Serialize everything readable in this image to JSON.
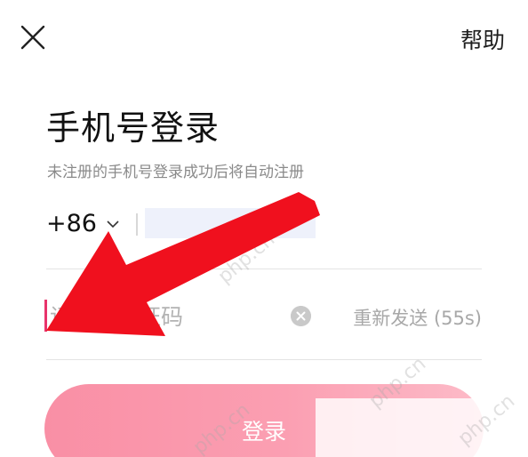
{
  "header": {
    "close_icon": "close-icon",
    "help_label": "帮助"
  },
  "login": {
    "title": "手机号登录",
    "subtitle": "未注册的手机号登录成功后将自动注册",
    "country_code": "+86",
    "code_placeholder": "请输入验证码",
    "resend_label": "重新发送 (55s)",
    "submit_label": "登录"
  },
  "watermark": "php.cn",
  "annotation": {
    "type": "red-arrow",
    "color": "#f0101e"
  },
  "colors": {
    "accent": "#e8336b",
    "button_gradient_start": "#f98fa5",
    "button_gradient_end": "#fdbbc8"
  }
}
